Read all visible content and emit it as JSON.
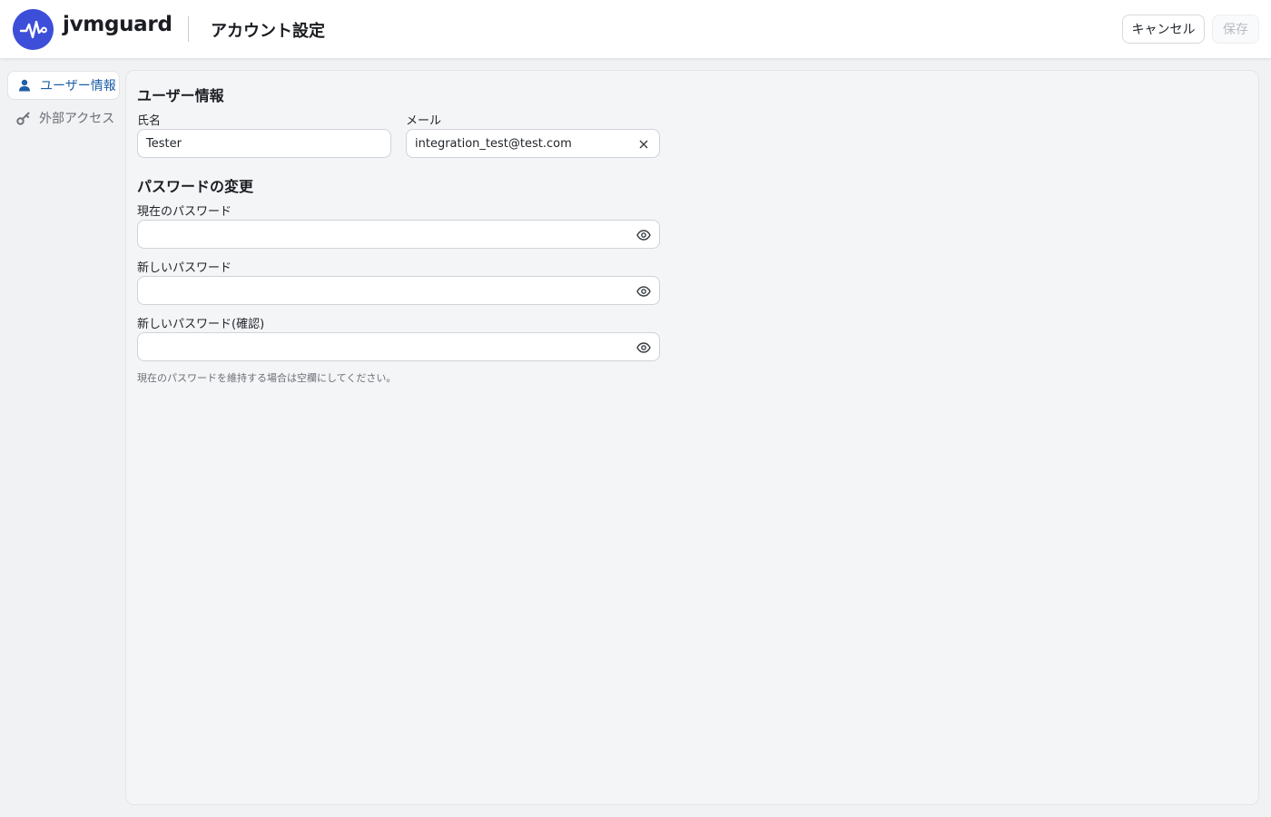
{
  "header": {
    "brand": "jvmguard",
    "title": "アカウント設定",
    "cancel_label": "キャンセル",
    "save_label": "保存",
    "logo_color": "#3d4fd9"
  },
  "sidebar": {
    "items": [
      {
        "label": "ユーザー情報",
        "icon": "user-icon",
        "active": true
      },
      {
        "label": "外部アクセス",
        "icon": "key-icon",
        "active": false
      }
    ]
  },
  "user_info": {
    "title": "ユーザー情報",
    "name_label": "氏名",
    "name_value": "Tester",
    "email_label": "メール",
    "email_value": "integration_test@test.com"
  },
  "password": {
    "title": "パスワードの変更",
    "current_label": "現在のパスワード",
    "new_label": "新しいパスワード",
    "confirm_label": "新しいパスワード(確認)",
    "hint": "現在のパスワードを維持する場合は空欄にしてください。"
  }
}
